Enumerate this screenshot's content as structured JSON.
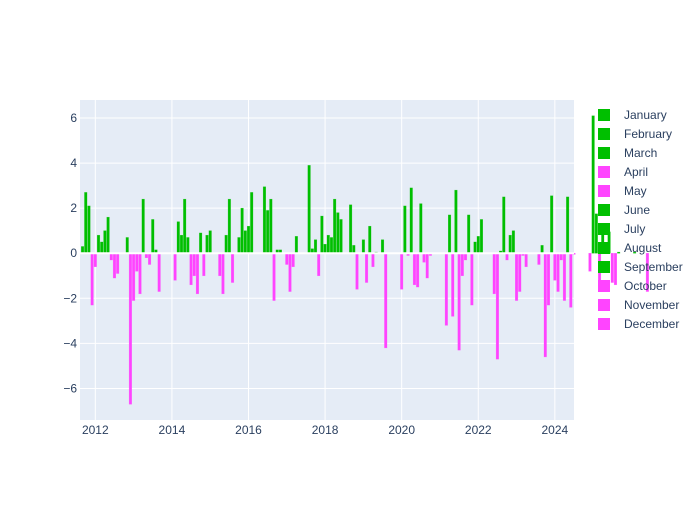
{
  "chart_data": {
    "type": "bar",
    "title": "",
    "xlabel": "",
    "ylabel": "",
    "xlim": [
      2011.6,
      2024.5
    ],
    "ylim": [
      -7.4,
      6.8
    ],
    "grid": true,
    "legend_placement": "right",
    "x_ticks": [
      "2012",
      "2014",
      "2016",
      "2018",
      "2020",
      "2022",
      "2024"
    ],
    "x_tick_values": [
      2012,
      2014,
      2016,
      2018,
      2020,
      2022,
      2024
    ],
    "y_ticks": [
      "−6",
      "−4",
      "−2",
      "0",
      "2",
      "4",
      "6"
    ],
    "y_tick_values": [
      -6,
      -4,
      -2,
      0,
      2,
      4,
      6
    ],
    "colors": {
      "positive": "#00bf00",
      "negative": "#ff44ff",
      "plot_bg": "#e5ecf6",
      "grid": "#ffffff"
    },
    "legend": [
      {
        "name": "January",
        "color": "#00bf00"
      },
      {
        "name": "February",
        "color": "#00bf00"
      },
      {
        "name": "March",
        "color": "#00bf00"
      },
      {
        "name": "April",
        "color": "#ff44ff"
      },
      {
        "name": "May",
        "color": "#ff44ff"
      },
      {
        "name": "June",
        "color": "#00bf00"
      },
      {
        "name": "July",
        "color": "#00bf00"
      },
      {
        "name": "August",
        "color": "#00bf00"
      },
      {
        "name": "September",
        "color": "#00bf00"
      },
      {
        "name": "October",
        "color": "#ff44ff"
      },
      {
        "name": "November",
        "color": "#ff44ff"
      },
      {
        "name": "December",
        "color": "#ff44ff"
      }
    ],
    "start": "2011-09",
    "values": [
      0.3,
      2.7,
      2.1,
      -2.3,
      -0.6,
      0.8,
      0.5,
      1.0,
      1.6,
      -0.3,
      -1.1,
      -0.9,
      0,
      0,
      0.7,
      -6.7,
      -2.1,
      -0.8,
      -1.8,
      2.4,
      -0.2,
      -0.5,
      1.5,
      0.15,
      -1.7,
      0,
      0,
      0,
      0,
      -1.2,
      1.4,
      0.8,
      2.4,
      0.7,
      -1.4,
      -1.0,
      -1.8,
      0.9,
      -1.0,
      0.8,
      1.0,
      0,
      0,
      -1.0,
      -1.8,
      0.8,
      2.4,
      -1.3,
      0,
      0.7,
      2.0,
      1.0,
      1.2,
      2.7,
      0,
      0,
      0,
      2.95,
      1.9,
      2.4,
      -2.1,
      0.15,
      0.15,
      0,
      -0.5,
      -1.7,
      -0.6,
      0.75,
      0,
      0,
      0,
      3.9,
      0.2,
      0.6,
      -1.0,
      1.65,
      0.4,
      0.8,
      0.7,
      2.4,
      1.8,
      1.5,
      0,
      0,
      2.15,
      0.35,
      -1.6,
      0,
      0.6,
      -1.3,
      1.2,
      -0.6,
      0.05,
      0,
      0.6,
      -4.2,
      0,
      0,
      0,
      0,
      -1.6,
      2.1,
      -0.1,
      2.9,
      -1.4,
      -1.5,
      2.2,
      -0.4,
      -1.1,
      -0.1,
      0,
      0,
      0,
      0,
      -3.2,
      1.7,
      -2.8,
      2.8,
      -4.3,
      -1.0,
      -0.3,
      1.7,
      -2.3,
      0.5,
      0.75,
      1.5,
      0,
      0,
      0,
      -1.8,
      -4.7,
      0.1,
      2.5,
      -0.3,
      0.8,
      1.0,
      -2.1,
      -1.7,
      -0.1,
      -0.6,
      0,
      0,
      0,
      -0.5,
      0.35,
      -4.6,
      -2.3,
      2.55,
      -1.2,
      -1.7,
      -0.3,
      -2.1,
      2.5,
      -2.4,
      -0.05,
      0,
      0,
      0,
      0,
      -0.8,
      6.1,
      1.75,
      -1.4,
      1.3,
      0.05,
      0.95,
      -1.3,
      -1.4,
      0.05,
      0,
      0,
      0,
      0,
      0.05,
      0,
      0,
      0,
      -1.7
    ]
  }
}
